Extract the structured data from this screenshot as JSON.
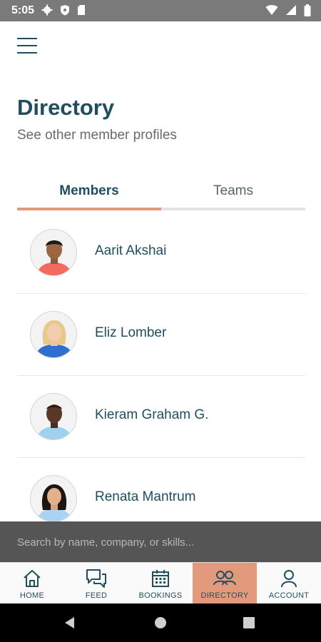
{
  "status": {
    "time": "5:05"
  },
  "header": {
    "menu_icon": "hamburger-menu-icon"
  },
  "page": {
    "title": "Directory",
    "subtitle": "See other member profiles"
  },
  "tabs": [
    {
      "label": "Members",
      "active": true
    },
    {
      "label": "Teams",
      "active": false
    }
  ],
  "members": [
    {
      "name": "Aarit Akshai"
    },
    {
      "name": "Eliz Lomber"
    },
    {
      "name": "Kieram Graham G."
    },
    {
      "name": "Renata Mantrum"
    }
  ],
  "search": {
    "placeholder": "Search by name, company, or skills..."
  },
  "nav": [
    {
      "label": "HOME",
      "icon": "home-icon"
    },
    {
      "label": "FEED",
      "icon": "feed-icon"
    },
    {
      "label": "BOOKINGS",
      "icon": "calendar-icon"
    },
    {
      "label": "DIRECTORY",
      "icon": "people-icon",
      "active": true
    },
    {
      "label": "ACCOUNT",
      "icon": "account-icon"
    }
  ],
  "colors": {
    "primary": "#1f4e5f",
    "accent": "#e39a7c",
    "statusbar": "#7a7a7a",
    "searchbar": "#555555"
  }
}
